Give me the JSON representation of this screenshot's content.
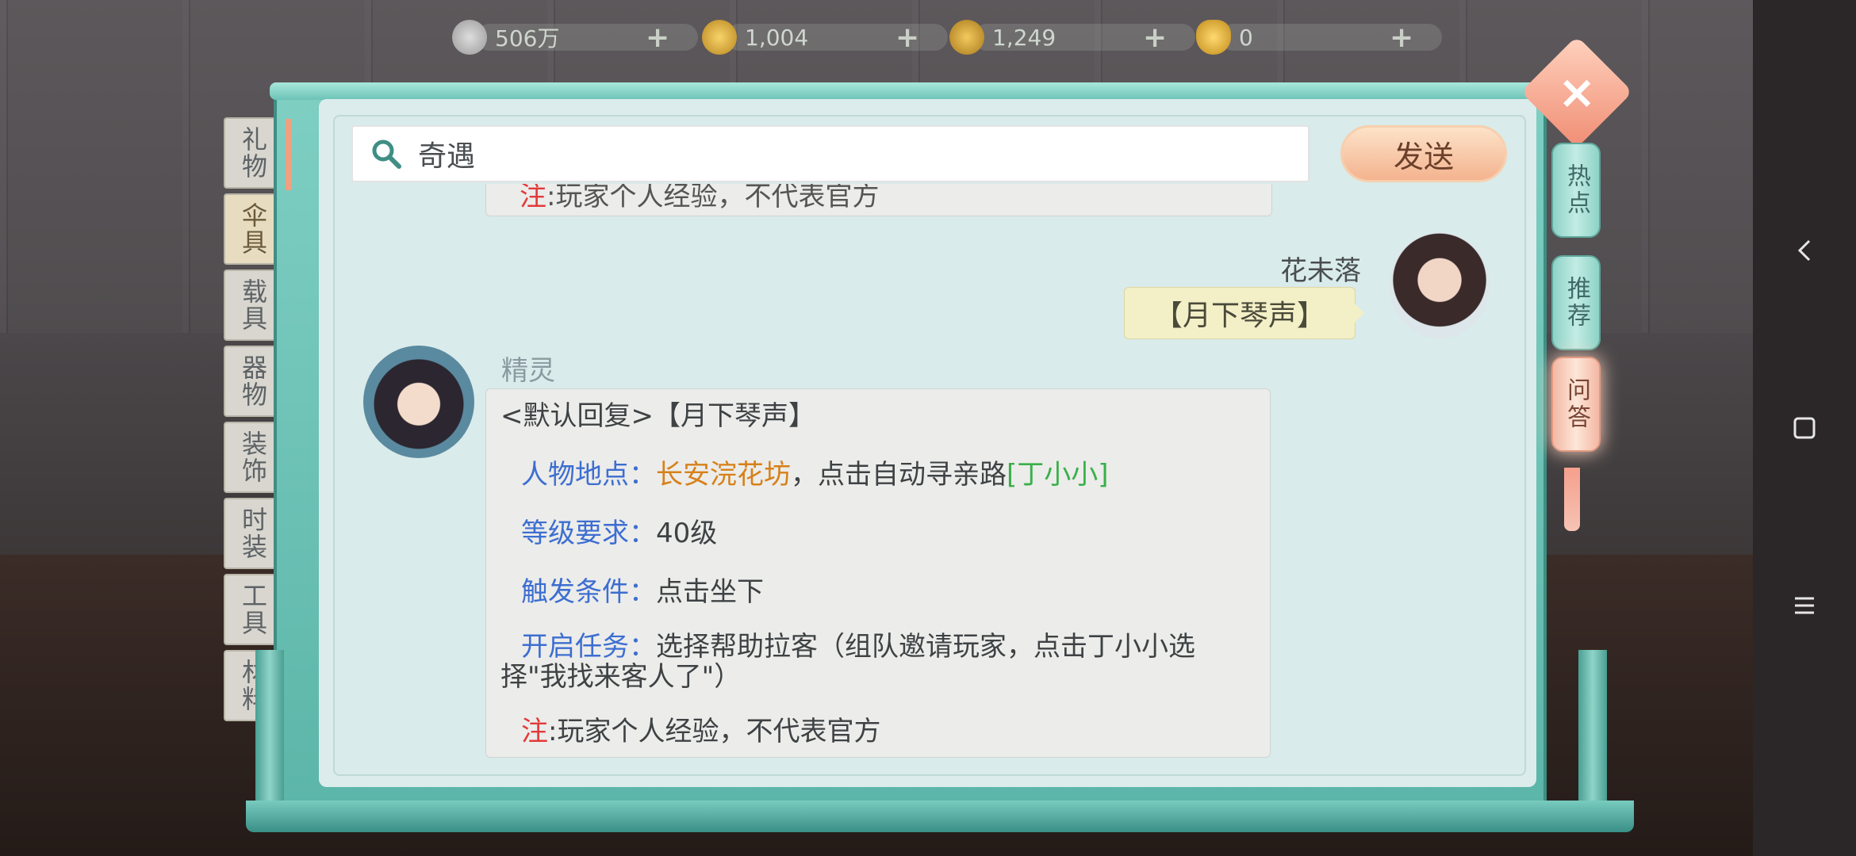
{
  "currencies": [
    {
      "icon": "silver-coin-icon",
      "value": "506万"
    },
    {
      "icon": "gold-coin-icon",
      "value": "1,004"
    },
    {
      "icon": "ingot-token-icon",
      "value": "1,249"
    },
    {
      "icon": "gold-ingot-icon",
      "value": "0"
    }
  ],
  "tabs": [
    "礼物",
    "伞具",
    "载具",
    "器物",
    "装饰",
    "时装",
    "工具",
    "材料"
  ],
  "search": {
    "value": "奇遇",
    "send_label": "发送"
  },
  "chat": {
    "cut_message": "注:玩家个人经验，不代表官方",
    "user_name": "花未落",
    "user_message": "【月下琴声】",
    "bot_name": "精灵",
    "reply": {
      "header": "<默认回复>【月下琴声】",
      "location_label": "人物地点：",
      "location_place": "长安浣花坊",
      "location_mid": "，点击自动寻亲路",
      "location_npc": "[丁小小]",
      "level_label": "等级要求：",
      "level_value": "40级",
      "trigger_label": "触发条件：",
      "trigger_value": "点击坐下",
      "task_label": "开启任务：",
      "task_value": "选择帮助拉客（组队邀请玩家，点击丁小小选择\"我找来客人了\"）",
      "note_label": "注",
      "note_value": ":玩家个人经验，不代表官方"
    }
  },
  "side_tabs": [
    "热点",
    "推荐",
    "问答"
  ],
  "colors": {
    "label_blue": "#3d6ed1",
    "place_orange": "#d6811a",
    "npc_green": "#39b04a",
    "note_red": "#e23a3a",
    "frame_teal": "#6cc3b6"
  }
}
